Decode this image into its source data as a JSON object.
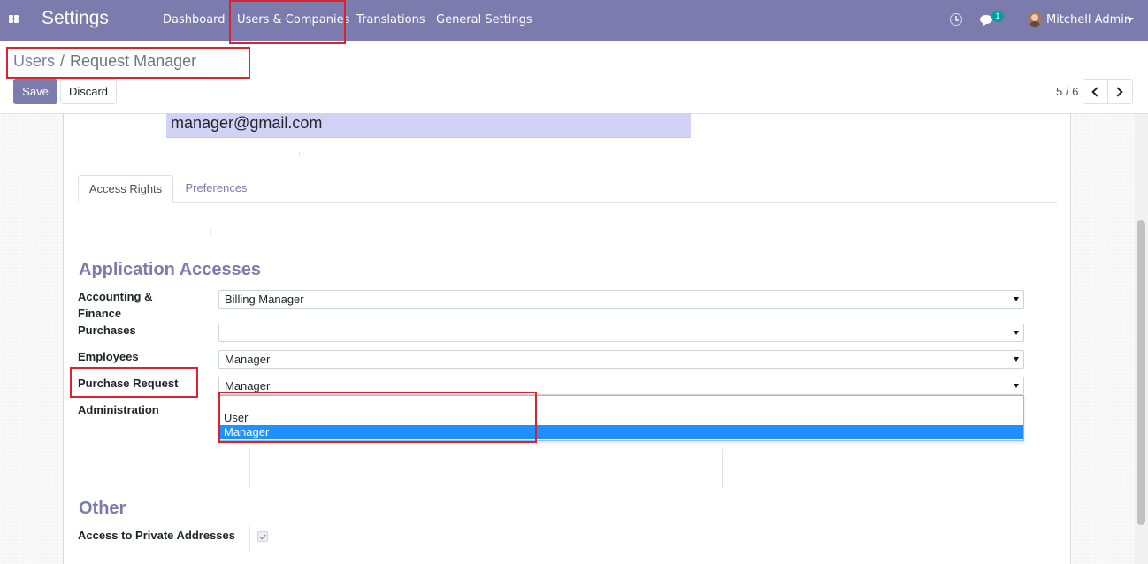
{
  "navbar": {
    "brand": "Settings",
    "items": [
      {
        "label": "Dashboard"
      },
      {
        "label": "Users & Companies"
      },
      {
        "label": "Translations"
      },
      {
        "label": "General Settings"
      }
    ],
    "chat_badge": "1",
    "user_name": "Mitchell Admin"
  },
  "control_panel": {
    "breadcrumb": {
      "parent": "Users",
      "separator": "/",
      "current": "Request Manager"
    },
    "save_label": "Save",
    "discard_label": "Discard",
    "pager": "5 / 6"
  },
  "form": {
    "email": "manager@gmail.com",
    "tabs": [
      {
        "label": "Access Rights",
        "active": true
      },
      {
        "label": "Preferences",
        "active": false
      }
    ],
    "application_accesses": {
      "title": "Application Accesses",
      "fields": [
        {
          "label_line1": "Accounting &",
          "label_line2": "Finance",
          "value": "Billing Manager"
        },
        {
          "label": "Purchases",
          "value": ""
        },
        {
          "label": "Employees",
          "value": "Manager"
        },
        {
          "label": "Purchase Request",
          "value": "Manager"
        },
        {
          "label": "Administration",
          "value": ""
        }
      ],
      "dropdown_options": [
        {
          "label": "",
          "selected": false
        },
        {
          "label": "User",
          "selected": false
        },
        {
          "label": "Manager",
          "selected": true
        }
      ]
    },
    "other": {
      "title": "Other",
      "private_addresses_label": "Access to Private Addresses",
      "private_addresses_checked": true
    }
  },
  "colors": {
    "brand": "#7c7bad",
    "highlight": "#d9232e",
    "selected_option": "#1e90ff",
    "email_bg": "#d2d2f7"
  }
}
